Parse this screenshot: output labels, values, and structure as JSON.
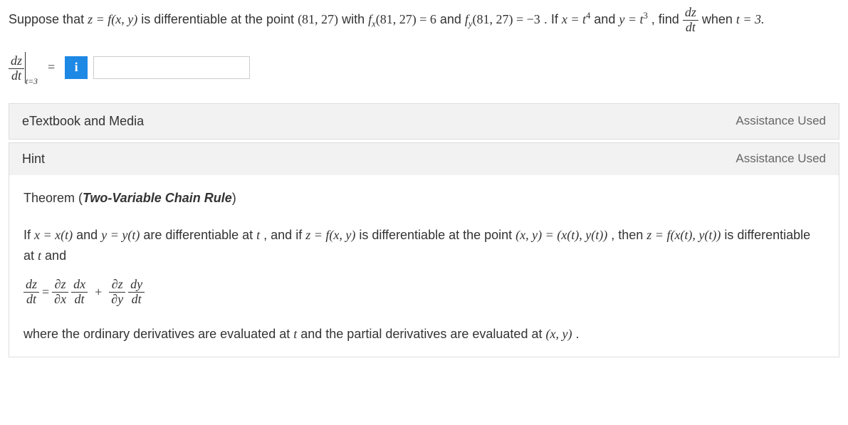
{
  "question": {
    "prefix": "Suppose that ",
    "z_eq": "z = f(x, y)",
    "mid1": " is differentiable at the point ",
    "point": "(81, 27)",
    "mid2": " with ",
    "fx": "f",
    "fx_sub": "x",
    "fx_args": "(81, 27) = 6",
    "and1": " and ",
    "fy": "f",
    "fy_sub": "y",
    "fy_args": "(81, 27) = −3",
    "mid3": ". If ",
    "x_eq1": "x = t",
    "x_exp": "4",
    "and2": " and ",
    "y_eq1": "y = t",
    "y_exp": "3",
    "mid4": ", find ",
    "dz": "dz",
    "dt": "dt",
    "when": " when ",
    "t_val": "t = 3."
  },
  "answer": {
    "dz": "dz",
    "dt": "dt",
    "sub": "t=3",
    "equals": "=",
    "info": "i",
    "placeholder": ""
  },
  "accordion1": {
    "title": "eTextbook and Media",
    "assistance": "Assistance Used"
  },
  "accordion2": {
    "title": "Hint",
    "assistance": "Assistance Used"
  },
  "hint": {
    "theorem_prefix": "Theorem (",
    "theorem_name": "Two-Variable Chain Rule",
    "theorem_suffix": ")",
    "p1_a": "If ",
    "p1_b": "x = x(t)",
    "p1_c": " and  ",
    "p1_d": "y = y(t)",
    "p1_e": " are differentiable at ",
    "p1_f": "t",
    "p1_g": ", and if ",
    "p1_h": "z = f(x, y)",
    "p1_i": " is differentiable at the point ",
    "p1_j": "(x, y) = (x(t), y(t))",
    "p1_k": ", then ",
    "p1_l": "z = f(x(t), y(t))",
    "p1_m": " is differentiable at ",
    "p1_n": "t",
    "p1_o": " and",
    "eq_dz": "dz",
    "eq_dt": "dt",
    "eq_eq": "=",
    "eq_pz": "∂z",
    "eq_px": "∂x",
    "eq_dx": "dx",
    "eq_plus": "+",
    "eq_py": "∂y",
    "eq_dy": "dy",
    "p2": "where the ordinary derivatives are evaluated at ",
    "p2_t": "t",
    "p2_b": " and the partial derivatives are evaluated at ",
    "p2_xy": "(x, y)",
    "p2_c": "."
  }
}
